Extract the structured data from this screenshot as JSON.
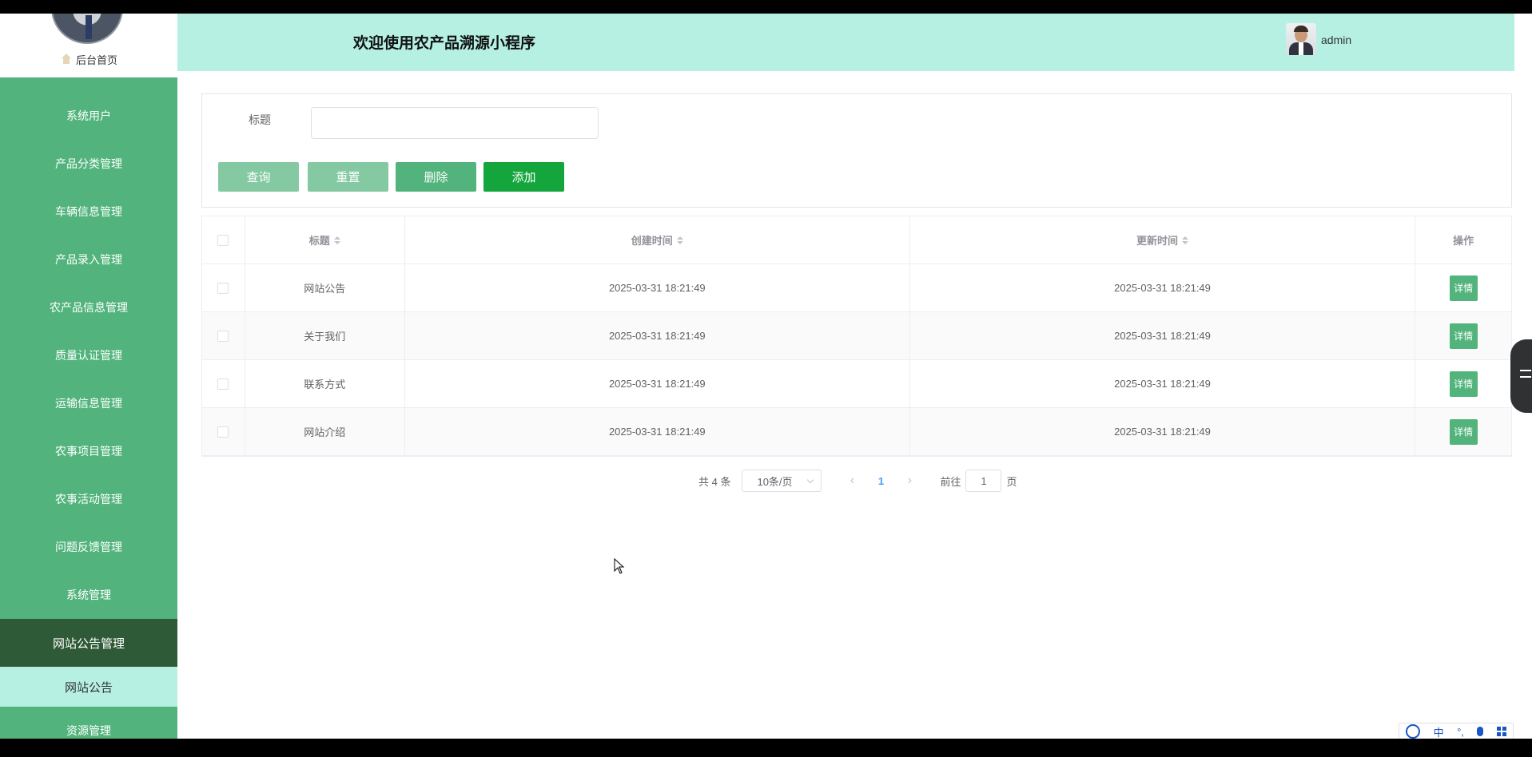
{
  "header": {
    "title": "欢迎使用农产品溯源小程序",
    "username": "admin"
  },
  "sidebar": {
    "home_label": "后台首页",
    "items": [
      {
        "label": "系统用户"
      },
      {
        "label": "产品分类管理"
      },
      {
        "label": "车辆信息管理"
      },
      {
        "label": "产品录入管理"
      },
      {
        "label": "农产品信息管理"
      },
      {
        "label": "质量认证管理"
      },
      {
        "label": "运输信息管理"
      },
      {
        "label": "农事项目管理"
      },
      {
        "label": "农事活动管理"
      },
      {
        "label": "问题反馈管理"
      },
      {
        "label": "系统管理"
      },
      {
        "label": "网站公告管理"
      },
      {
        "label": "资源管理"
      }
    ],
    "active_sub": "网站公告"
  },
  "search": {
    "label": "标题",
    "value": ""
  },
  "buttons": {
    "query": "查询",
    "reset": "重置",
    "delete": "删除",
    "add": "添加"
  },
  "table": {
    "headers": {
      "title": "标题",
      "created": "创建时间",
      "updated": "更新时间",
      "actions": "操作"
    },
    "detail_label": "详情",
    "rows": [
      {
        "title": "网站公告",
        "created": "2025-03-31 18:21:49",
        "updated": "2025-03-31 18:21:49"
      },
      {
        "title": "关于我们",
        "created": "2025-03-31 18:21:49",
        "updated": "2025-03-31 18:21:49"
      },
      {
        "title": "联系方式",
        "created": "2025-03-31 18:21:49",
        "updated": "2025-03-31 18:21:49"
      },
      {
        "title": "网站介绍",
        "created": "2025-03-31 18:21:49",
        "updated": "2025-03-31 18:21:49"
      }
    ]
  },
  "pagination": {
    "total": "共 4 条",
    "page_size": "10条/页",
    "current_page": "1",
    "goto_label": "前往",
    "goto_value": "1",
    "page_unit": "页"
  },
  "ime": {
    "mode": "中"
  },
  "colors": {
    "sidebar_bg": "#52b47c",
    "sidebar_active": "#2f5a37",
    "header_bg": "#b5f0e2",
    "add_button": "#14a63c",
    "detail_button": "#52b47c"
  }
}
